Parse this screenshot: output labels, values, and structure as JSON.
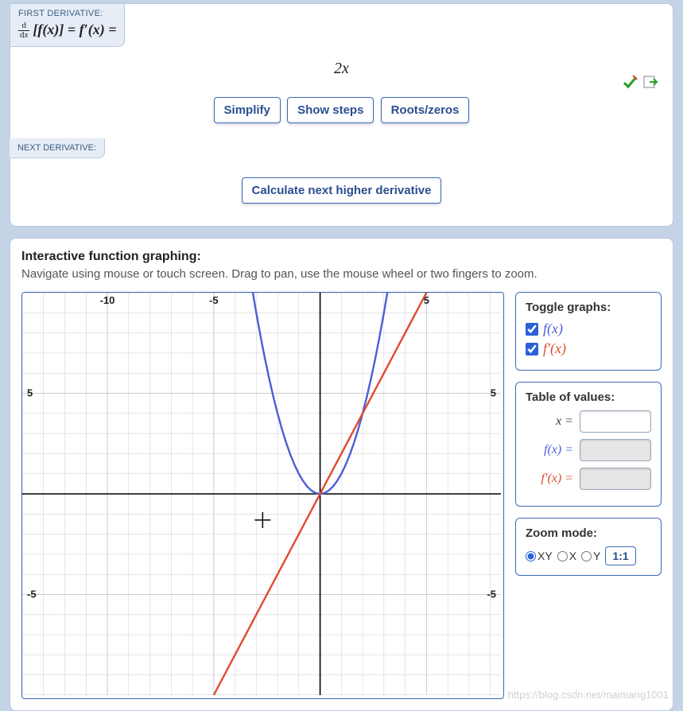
{
  "first_derivative": {
    "tab_label": "FIRST DERIVATIVE:",
    "prefix_html": "d/dx [f(x)] = f′(x) =",
    "result": "2x",
    "buttons": {
      "simplify": "Simplify",
      "steps": "Show steps",
      "roots": "Roots/zeros"
    }
  },
  "next_derivative": {
    "tab_label": "NEXT DERIVATIVE:",
    "button": "Calculate next higher derivative"
  },
  "graph_section": {
    "title": "Interactive function graphing:",
    "subtitle": "Navigate using mouse or touch screen. Drag to pan, use the mouse wheel or two fingers to zoom.",
    "toggle": {
      "title": "Toggle graphs:",
      "fx_label": "f(x)",
      "fpx_label": "f′(x)",
      "fx_checked": true,
      "fpx_checked": true
    },
    "table": {
      "title": "Table of values:",
      "x_label": "x =",
      "fx_label": "f(x) =",
      "fpx_label": "f′(x) =",
      "x_value": "",
      "fx_value": "",
      "fpx_value": ""
    },
    "zoom": {
      "title": "Zoom mode:",
      "xy": "XY",
      "x": "X",
      "y": "Y",
      "reset": "1:1",
      "selected": "XY"
    }
  },
  "chart_data": {
    "type": "line",
    "title": "",
    "xlabel": "",
    "ylabel": "",
    "xlim": [
      -14,
      8.5
    ],
    "ylim": [
      -10,
      10
    ],
    "xticks": [
      -10,
      -5,
      5
    ],
    "yticks": [
      -5,
      5
    ],
    "grid": true,
    "series": [
      {
        "name": "f(x) = x²",
        "color": "#4a5ed6",
        "x": [
          -3.2,
          -3,
          -2.8,
          -2.6,
          -2.4,
          -2.2,
          -2,
          -1.8,
          -1.6,
          -1.4,
          -1.2,
          -1,
          -0.8,
          -0.6,
          -0.4,
          -0.2,
          0,
          0.2,
          0.4,
          0.6,
          0.8,
          1,
          1.2,
          1.4,
          1.6,
          1.8,
          2,
          2.2,
          2.4,
          2.6,
          2.8,
          3,
          3.2
        ],
        "y": [
          10.24,
          9,
          7.84,
          6.76,
          5.76,
          4.84,
          4,
          3.24,
          2.56,
          1.96,
          1.44,
          1,
          0.64,
          0.36,
          0.16,
          0.04,
          0,
          0.04,
          0.16,
          0.36,
          0.64,
          1,
          1.44,
          1.96,
          2.56,
          3.24,
          4,
          4.84,
          5.76,
          6.76,
          7.84,
          9,
          10.24
        ]
      },
      {
        "name": "f′(x) = 2x",
        "color": "#e04b2f",
        "x": [
          -5,
          5
        ],
        "y": [
          -10,
          10
        ]
      }
    ],
    "crosshair": {
      "x": -2.7,
      "y": -1.3
    }
  },
  "watermark": "https://blog.csdn.net/maimang1001"
}
